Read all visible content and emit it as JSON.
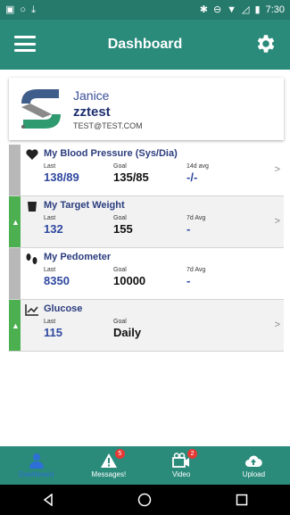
{
  "status_bar": {
    "time": "7:30"
  },
  "app_bar": {
    "title": "Dashboard"
  },
  "profile": {
    "first_name": "Janice",
    "username": "zztest",
    "email": "TEST@TEST.COM"
  },
  "rows": [
    {
      "title": "My Blood Pressure  (Sys/Dia)",
      "c1_label": "Last",
      "c1_value": "138/89",
      "c2_label": "Goal",
      "c2_value": "135/85",
      "c3_label": "14d avg",
      "c3_value": "-/-",
      "strip": "gray",
      "icon": "heart-icon"
    },
    {
      "title": "My Target Weight",
      "c1_label": "Last",
      "c1_value": "132",
      "c2_label": "Goal",
      "c2_value": "155",
      "c3_label": "7d Avg",
      "c3_value": "-",
      "strip": "green",
      "icon": "scale-icon"
    },
    {
      "title": "My Pedometer",
      "c1_label": "Last",
      "c1_value": "8350",
      "c2_label": "Goal",
      "c2_value": "10000",
      "c3_label": "7d Avg",
      "c3_value": "-",
      "strip": "gray",
      "icon": "footprints-icon"
    },
    {
      "title": "Glucose",
      "c1_label": "Last",
      "c1_value": "115",
      "c2_label": "Goal",
      "c2_value": "Daily",
      "strip": "green",
      "icon": "chart-icon"
    }
  ],
  "bottom_nav": [
    {
      "label": "Dashboard",
      "icon": "person-icon",
      "active": true
    },
    {
      "label": "Messages!",
      "icon": "alert-icon",
      "badge": "5"
    },
    {
      "label": "Video",
      "icon": "video-icon",
      "badge": "2"
    },
    {
      "label": "Upload",
      "icon": "cloud-upload-icon"
    }
  ],
  "colors": {
    "primary": "#2a8b7b",
    "status": "#267a6c",
    "accent_blue": "#2f48a0",
    "strip_green": "#4caf50",
    "strip_gray": "#b8b8b8",
    "badge_red": "#e53935"
  }
}
